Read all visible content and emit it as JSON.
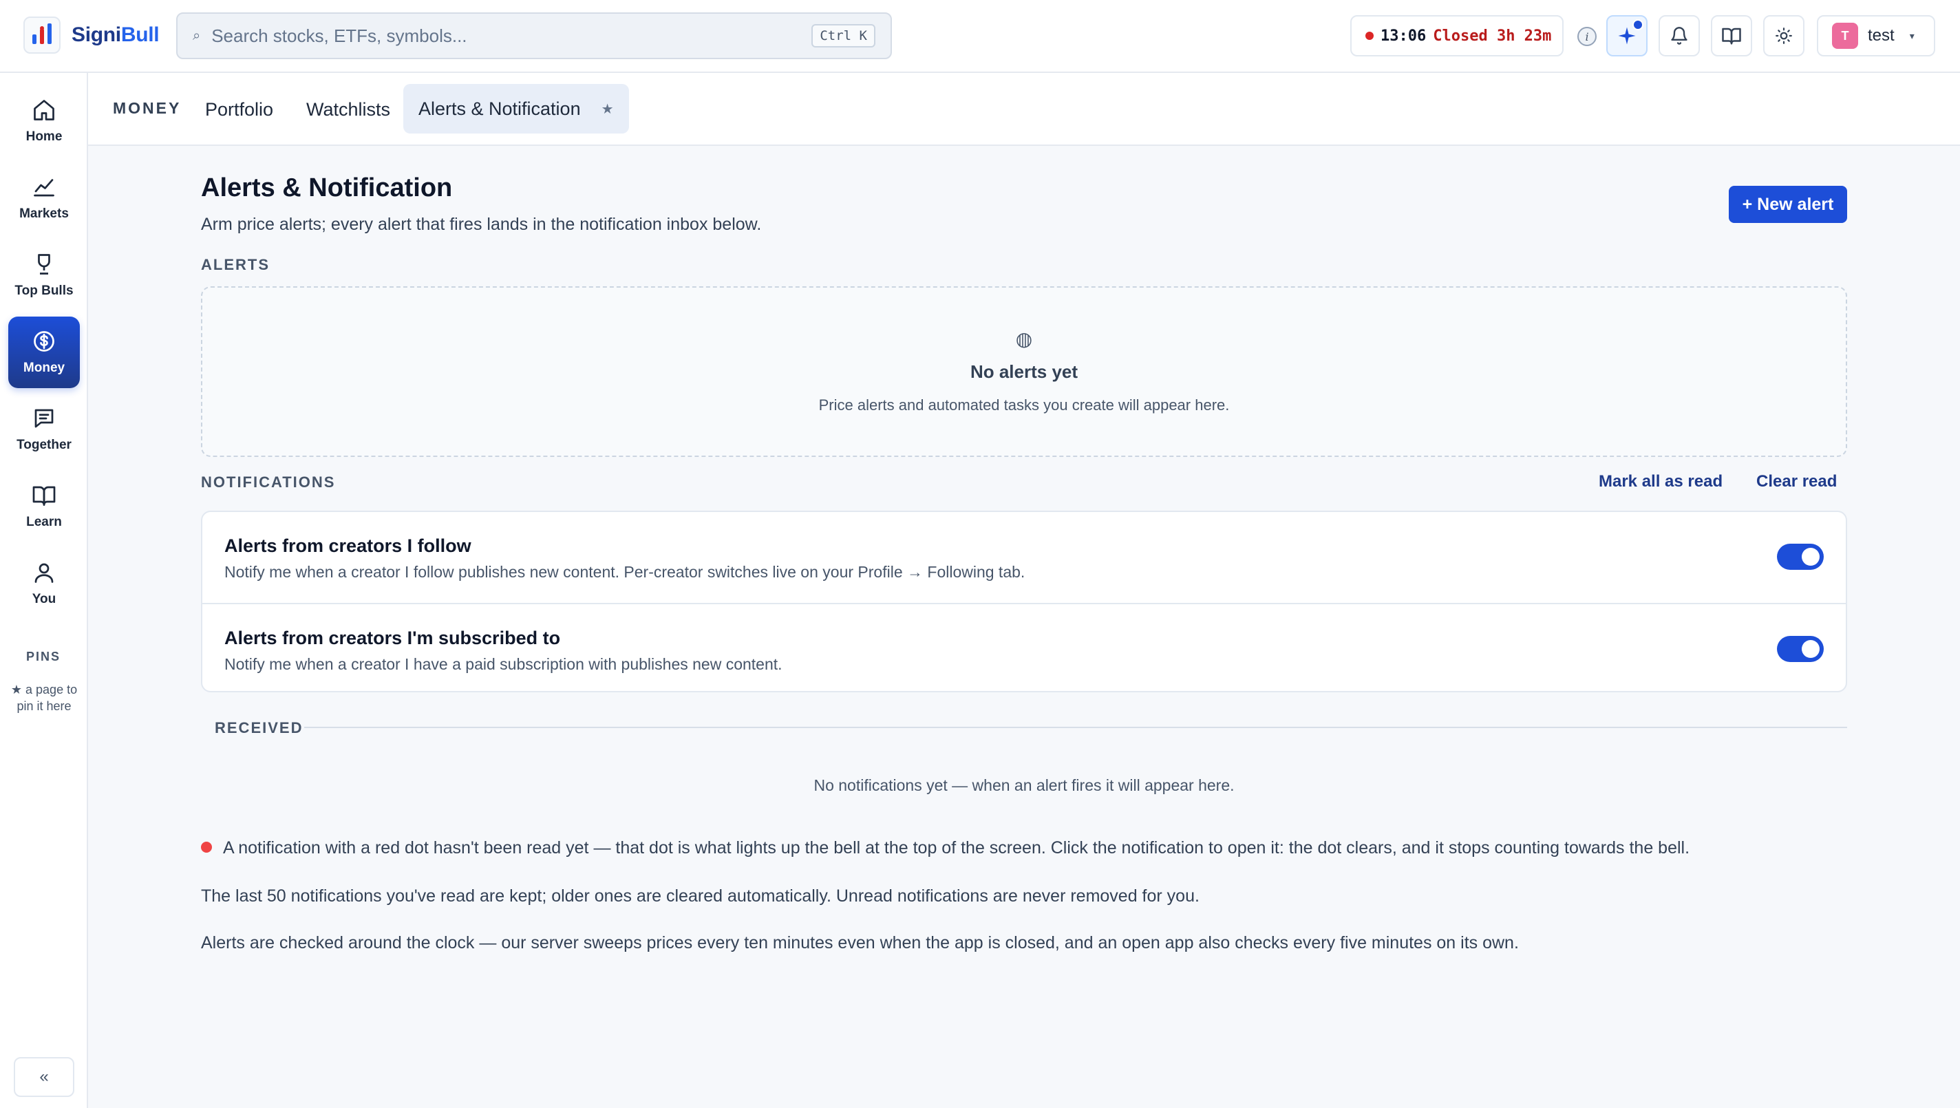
{
  "app": {
    "name_part1": "Signi",
    "name_part2": "Bull"
  },
  "search": {
    "placeholder": "Search stocks, ETFs, symbols...",
    "shortcut": "Ctrl K"
  },
  "market": {
    "time": "13:06",
    "status": "Closed 3h 23m"
  },
  "user": {
    "initial": "T",
    "name": "test"
  },
  "sidebar": {
    "items": [
      {
        "label": "Home",
        "icon": "home-icon"
      },
      {
        "label": "Markets",
        "icon": "chart-line-icon"
      },
      {
        "label": "Top Bulls",
        "icon": "trophy-icon"
      },
      {
        "label": "Money",
        "icon": "dollar-coin-icon",
        "active": true
      },
      {
        "label": "Together",
        "icon": "chat-icon"
      },
      {
        "label": "Learn",
        "icon": "book-icon"
      },
      {
        "label": "You",
        "icon": "user-icon"
      }
    ],
    "pins_title": "PINS",
    "pins_hint": "★ a page to pin it here",
    "collapse_label": "«"
  },
  "subnav": {
    "section": "MONEY",
    "tabs": [
      {
        "label": "Portfolio"
      },
      {
        "label": "Watchlists"
      },
      {
        "label": "Alerts & Notification",
        "active": true
      }
    ],
    "pin_star": "★"
  },
  "page": {
    "title": "Alerts & Notification",
    "subtitle": "Arm price alerts; every alert that fires lands in the notification inbox below.",
    "new_alert_label": "+ New alert"
  },
  "alerts": {
    "heading": "ALERTS",
    "empty_title": "No alerts yet",
    "empty_desc": "Price alerts and automated tasks you create will appear here."
  },
  "notifications": {
    "heading": "NOTIFICATIONS",
    "mark_all_read": "Mark all as read",
    "clear_read": "Clear read",
    "settings": [
      {
        "title": "Alerts from creators I follow",
        "desc": "Notify me when a creator I follow publishes new content. Per-creator switches live on your Profile → Following tab.",
        "enabled": true
      },
      {
        "title": "Alerts from creators I'm subscribed to",
        "desc": "Notify me when a creator I have a paid subscription with publishes new content.",
        "enabled": true
      }
    ],
    "received_heading": "RECEIVED",
    "empty": "No notifications yet — when an alert fires it will appear here."
  },
  "notes": [
    "A notification with a red dot hasn't been read yet — that dot is what lights up the bell at the top of the screen. Click the notification to open it: the dot clears, and it stops counting towards the bell.",
    "The last 50 notifications you've read are kept; older ones are cleared automatically. Unread notifications are never removed for you.",
    "Alerts are checked around the clock — our server sweeps prices every ten minutes even when the app is closed, and an open app also checks every five minutes on its own."
  ],
  "colors": {
    "accent": "#1d4ed8",
    "unread_dot": "#ef4444",
    "market_closed": "#b91c1c"
  }
}
